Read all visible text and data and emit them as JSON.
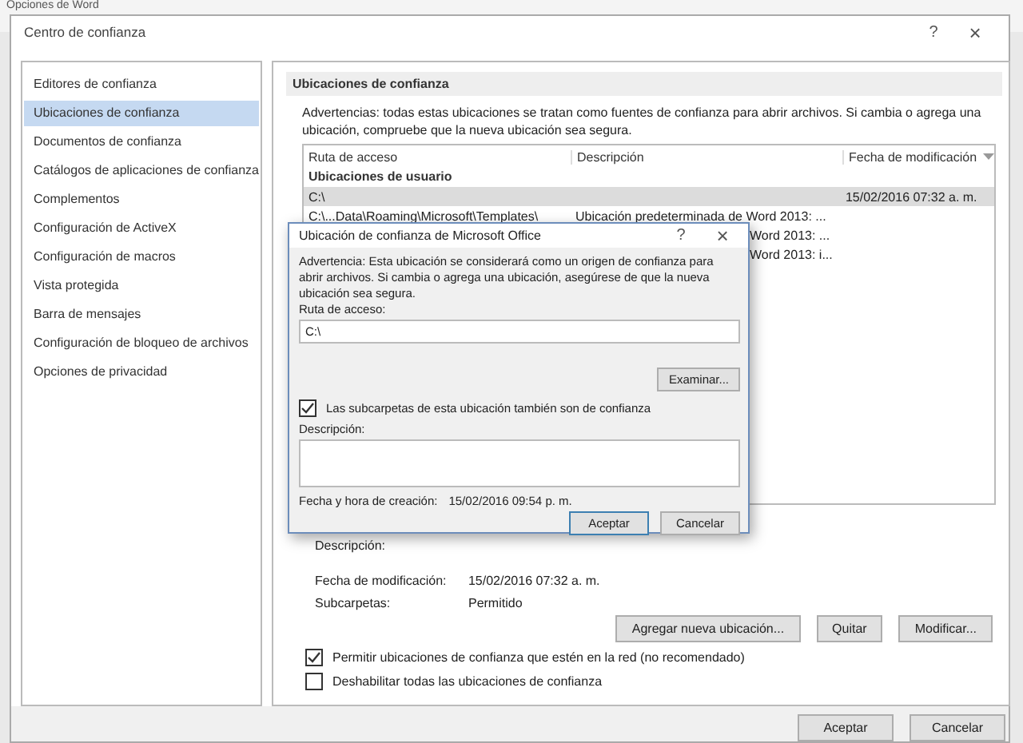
{
  "background_window": {
    "title": "Opciones de Word"
  },
  "window": {
    "title": "Centro de confianza",
    "help": "?",
    "close": "×"
  },
  "sidebar": {
    "items": [
      {
        "label": "Editores de confianza",
        "selected": false
      },
      {
        "label": "Ubicaciones de confianza",
        "selected": true
      },
      {
        "label": "Documentos de confianza",
        "selected": false
      },
      {
        "label": "Catálogos de aplicaciones de confianza",
        "selected": false
      },
      {
        "label": "Complementos",
        "selected": false
      },
      {
        "label": "Configuración de ActiveX",
        "selected": false
      },
      {
        "label": "Configuración de macros",
        "selected": false
      },
      {
        "label": "Vista protegida",
        "selected": false
      },
      {
        "label": "Barra de mensajes",
        "selected": false
      },
      {
        "label": "Configuración de bloqueo de archivos",
        "selected": false
      },
      {
        "label": "Opciones de privacidad",
        "selected": false
      }
    ]
  },
  "content": {
    "heading": "Ubicaciones de confianza",
    "warning": "Advertencias: todas estas ubicaciones se tratan como fuentes de confianza para abrir archivos. Si cambia o agrega una ubicación, compruebe que la nueva ubicación sea segura.",
    "table": {
      "columns": [
        "Ruta de acceso",
        "Descripción",
        "Fecha de modificación"
      ],
      "group": "Ubicaciones de usuario",
      "rows": [
        {
          "path": "C:\\",
          "date": "15/02/2016 07:32 a. m.",
          "selected": true
        },
        {
          "path": "C:\\...Data\\Roaming\\Microsoft\\Templates\\",
          "description": "Ubicación predeterminada de Word 2013: ...",
          "selected": false
        },
        {
          "description": "Word 2013: ...",
          "selected": false
        },
        {
          "description": "Word 2013: i...",
          "selected": false
        }
      ]
    },
    "details": [
      {
        "label": "Descripción:"
      },
      {
        "label": "Fecha de modificación:",
        "value": "15/02/2016 07:32 a. m."
      },
      {
        "label": "Subcarpetas:",
        "value": "Permitido"
      }
    ],
    "buttons": [
      "Agregar nueva ubicación...",
      "Quitar",
      "Modificar..."
    ],
    "options": [
      {
        "label": "Permitir ubicaciones de confianza que estén en la red (no recomendado)",
        "checked": true
      },
      {
        "label": "Deshabilitar todas las ubicaciones de confianza",
        "checked": false
      }
    ]
  },
  "footer_buttons": [
    "Aceptar",
    "Cancelar"
  ],
  "modal": {
    "title": "Ubicación de confianza de Microsoft Office",
    "help": "?",
    "close": "×",
    "warning": "Advertencia: Esta ubicación se considerará como un origen de confianza para abrir archivos. Si cambia o agrega una ubicación, asegúrese de que la nueva ubicación sea segura.",
    "path_label": "Ruta de acceso:",
    "path_value": "C:\\",
    "browse": "Examinar...",
    "subfolders": {
      "label": "Las subcarpetas de esta ubicación también son de confianza",
      "checked": true
    },
    "description_label": "Descripción:",
    "created_label": "Fecha y hora de creación:",
    "created_value": "15/02/2016 09:54 p. m.",
    "buttons": [
      "Aceptar",
      "Cancelar"
    ]
  }
}
